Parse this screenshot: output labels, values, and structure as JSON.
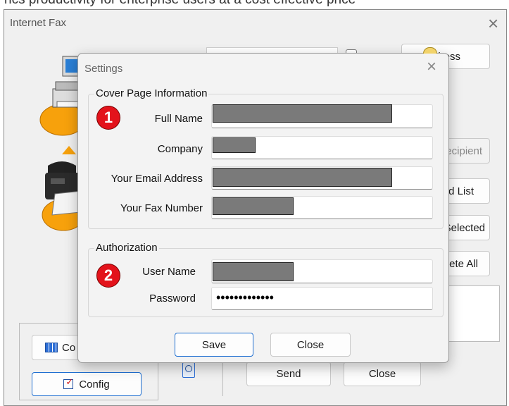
{
  "background_text": {
    "line": "ncs productivity for enterprise users at a cost effective price"
  },
  "main_window": {
    "title": "Internet Fax",
    "close_glyph": "×",
    "address_button": "Address",
    "recipient_button": "ecipient",
    "list_button": "d List",
    "selected_button": "Selected",
    "delete_all_button": "ete All",
    "co_button": "Co",
    "config_button": "Config",
    "send_button": "Send",
    "close_button": "Close"
  },
  "settings_dialog": {
    "title": "Settings",
    "close_glyph": "×",
    "cover_group": {
      "title": "Cover Page Information",
      "badge": "1",
      "full_name_label": "Full Name",
      "company_label": "Company",
      "email_label": "Your Email Address",
      "fax_label": "Your Fax Number"
    },
    "auth_group": {
      "title": "Authorization",
      "badge": "2",
      "username_label": "User Name",
      "password_label": "Password",
      "password_value": "•••••••••••••"
    },
    "save_button": "Save",
    "close_button": "Close"
  },
  "colors": {
    "dialog_bg": "#f3f3f3",
    "window_bg": "#f0f0f0",
    "badge": "#e3131b",
    "accent_border": "#1f6fd1",
    "redaction": "#7a7a7a"
  }
}
